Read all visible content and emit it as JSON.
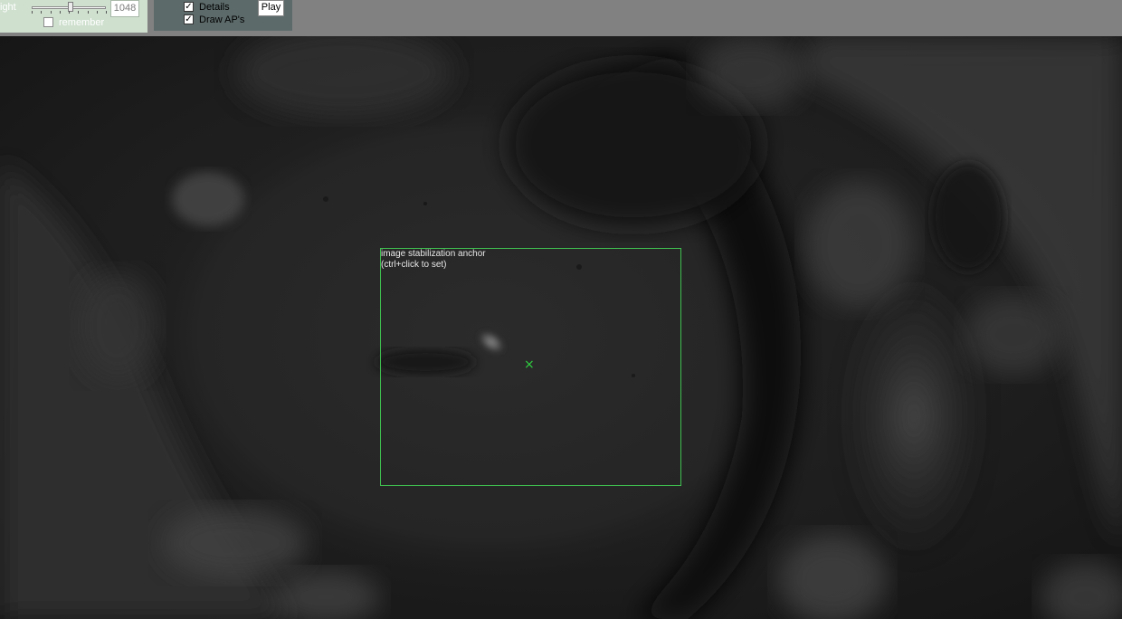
{
  "toolbar": {
    "height_control": {
      "label": "ight",
      "value": "1048",
      "slider_position_fraction": 0.52,
      "remember_label": "remember",
      "remember_checked": false
    },
    "display_options": {
      "details_label": "Details",
      "details_checked": true,
      "draw_aps_label": "Draw AP's",
      "draw_aps_checked": true,
      "play_label": "Play"
    }
  },
  "viewport": {
    "anchor": {
      "label_line1": "image stabilization anchor",
      "label_line2": "(ctrl+click to set)",
      "marker": "×"
    }
  },
  "colors": {
    "anchor_green": "#3fbf4f",
    "marker_green": "#2fd040",
    "panel_green": "#cfe0cf",
    "panel_dark": "#5d6a6a"
  },
  "icons": {
    "check": "check-icon",
    "marker": "cross-marker-icon"
  }
}
